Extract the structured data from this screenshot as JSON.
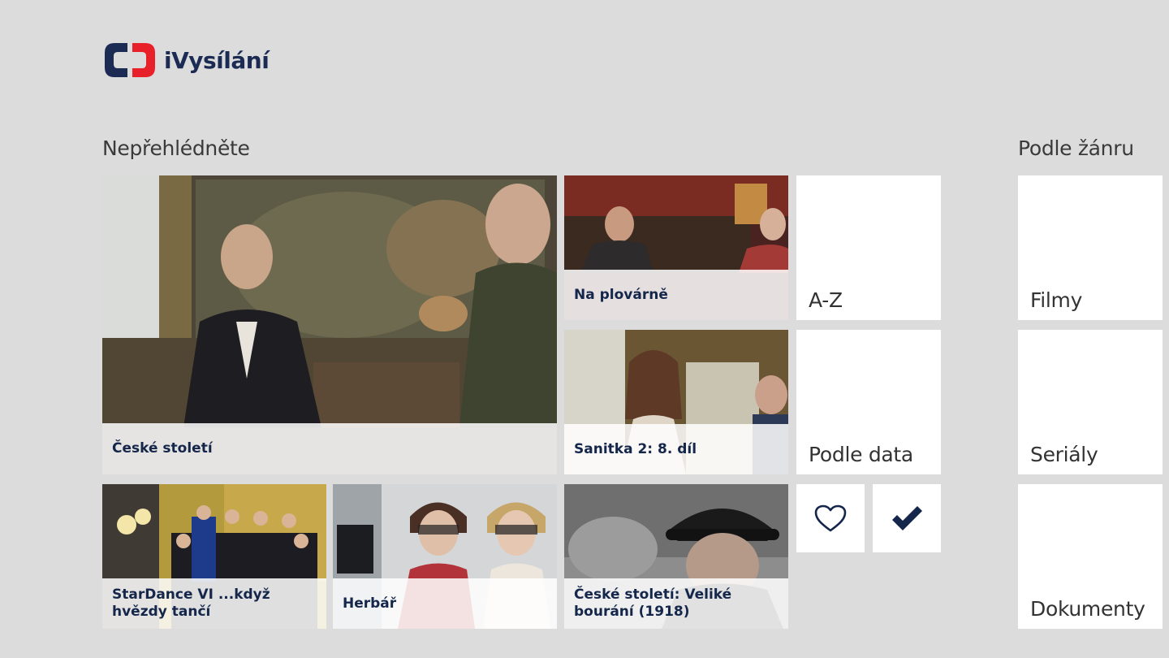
{
  "app": {
    "logo_text": "iVysílání",
    "logo_icon": "ct-logo-icon",
    "colors": {
      "brand_blue": "#1b2b54",
      "brand_red": "#e8202a",
      "background": "#dcdcdc"
    }
  },
  "featured": {
    "title": "Nepřehlédněte",
    "tiles": [
      {
        "title": "České století"
      },
      {
        "title": "Na plovárně"
      },
      {
        "title": "Sanitka 2: 8. díl"
      },
      {
        "title": "StarDance VI ...když hvězdy tančí"
      },
      {
        "title": "Herbář"
      },
      {
        "title": "České století: Veliké bourání (1918)"
      }
    ]
  },
  "browse": {
    "az_label": "A-Z",
    "by_date_label": "Podle data",
    "favorites_icon": "heart-icon",
    "watched_icon": "checkmark-icon"
  },
  "genres": {
    "title": "Podle žánru",
    "items": [
      {
        "label": "Filmy"
      },
      {
        "label": "Seriály"
      },
      {
        "label": "Dokumenty"
      }
    ]
  }
}
